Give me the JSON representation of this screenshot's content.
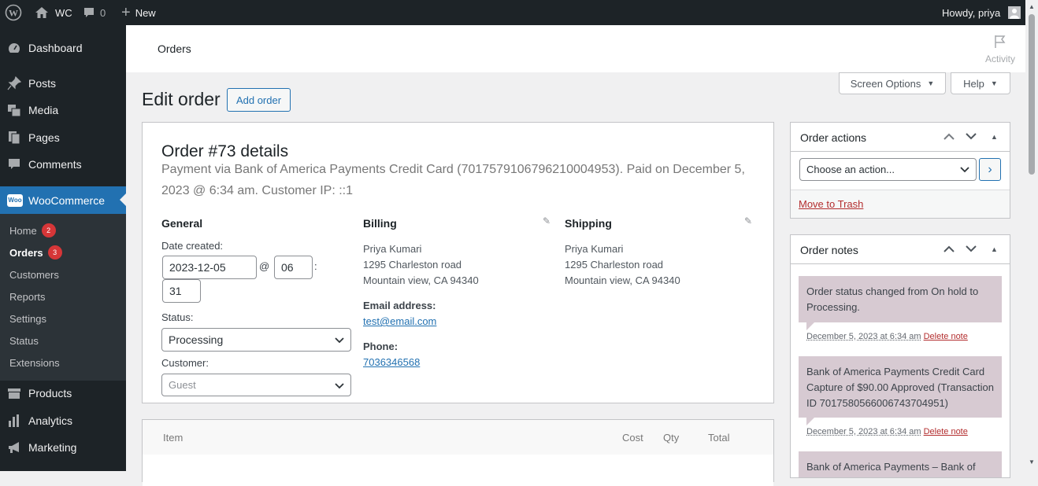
{
  "adminbar": {
    "site": "WC",
    "comments": "0",
    "new": "New",
    "howdy": "Howdy, priya"
  },
  "menu": {
    "dashboard": "Dashboard",
    "posts": "Posts",
    "media": "Media",
    "pages": "Pages",
    "comments": "Comments",
    "woocommerce": "WooCommerce",
    "products": "Products",
    "analytics": "Analytics",
    "marketing": "Marketing",
    "woo_logo": "Woo"
  },
  "submenu": {
    "home": "Home",
    "home_badge": "2",
    "orders": "Orders",
    "orders_badge": "3",
    "customers": "Customers",
    "reports": "Reports",
    "settings": "Settings",
    "status": "Status",
    "extensions": "Extensions"
  },
  "wcbar": {
    "title": "Orders",
    "activity": "Activity"
  },
  "screen_options": "Screen Options",
  "help": "Help",
  "page": {
    "title": "Edit order",
    "add_order": "Add order"
  },
  "order": {
    "heading": "Order #73 details",
    "payment_line1": "Payment via Bank of America Payments Credit Card (7017579106796210004953). Paid on December 5,",
    "payment_line2": "2023 @ 6:34 am. Customer IP: ::1",
    "general": {
      "heading": "General",
      "date_label": "Date created:",
      "date": "2023-12-05",
      "at": "@",
      "hour": "06",
      "colon": ":",
      "minute": "31",
      "status_label": "Status:",
      "status": "Processing",
      "customer_label": "Customer:",
      "customer": "Guest"
    },
    "billing": {
      "heading": "Billing",
      "name": "Priya Kumari",
      "street": "1295 Charleston road",
      "city": "Mountain view, CA 94340",
      "email_label": "Email address:",
      "email": "test@email.com",
      "phone_label": "Phone:",
      "phone": "7036346568"
    },
    "shipping": {
      "heading": "Shipping",
      "name": "Priya Kumari",
      "street": "1295 Charleston road",
      "city": "Mountain view, CA 94340"
    }
  },
  "items": {
    "item": "Item",
    "cost": "Cost",
    "qty": "Qty",
    "total": "Total"
  },
  "actions": {
    "heading": "Order actions",
    "select": "Choose an action...",
    "go": "›",
    "trash": "Move to Trash"
  },
  "notes": {
    "heading": "Order notes",
    "list": [
      {
        "text": "Order status changed from On hold to Processing.",
        "date": "December 5, 2023 at 6:34 am",
        "delete": "Delete note"
      },
      {
        "text": "Bank of America Payments Credit Card Capture of $90.00 Approved (Transaction ID 7017580566006743704951)",
        "date": "December 5, 2023 at 6:34 am",
        "delete": "Delete note"
      },
      {
        "text": "Bank of America Payments – Bank of"
      }
    ]
  },
  "colors": {
    "adminbar": "#1d2327",
    "accent": "#2271b1",
    "active_menu": "#2271b1",
    "note_bg": "#d7cad2",
    "badge": "#d63638"
  }
}
